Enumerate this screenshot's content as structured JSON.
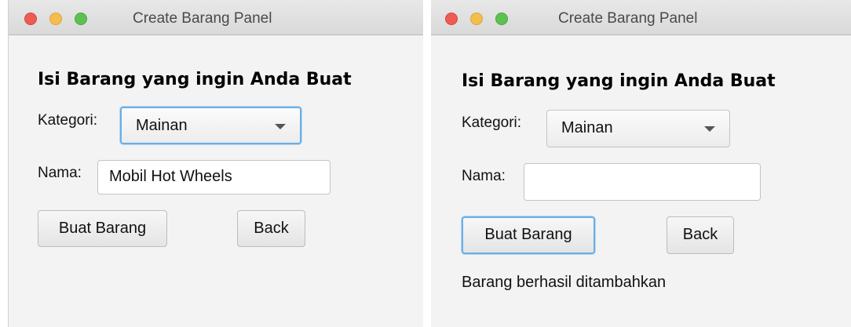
{
  "windows": [
    {
      "title": "Create Barang Panel",
      "heading": "Isi Barang yang ingin Anda Buat",
      "kategori_label": "Kategori:",
      "kategori_value": "Mainan",
      "nama_label": "Nama:",
      "nama_value": "Mobil Hot Wheels",
      "buat_button": "Buat Barang",
      "back_button": "Back"
    },
    {
      "title": "Create Barang Panel",
      "heading": "Isi Barang yang ingin Anda Buat",
      "kategori_label": "Kategori:",
      "kategori_value": "Mainan",
      "nama_label": "Nama:",
      "nama_value": "",
      "buat_button": "Buat Barang",
      "back_button": "Back",
      "status_message": "Barang berhasil ditambahkan"
    }
  ],
  "colors": {
    "close": "#ee5b53",
    "minimize": "#f4be4f",
    "maximize": "#5cc151",
    "focus_ring": "#6aaee4",
    "window_bg": "#f3f3f3"
  }
}
